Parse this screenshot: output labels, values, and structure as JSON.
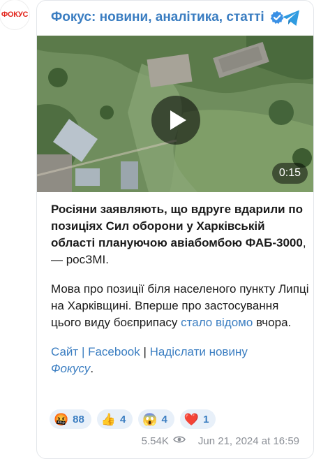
{
  "channel": {
    "avatar_text": "ФОКУС",
    "title": "Фокус: новини, аналітика, статті",
    "verified_icon": "verified-badge-icon",
    "share_icon": "telegram-share-icon"
  },
  "video": {
    "duration": "0:15",
    "play_icon": "play-icon"
  },
  "post": {
    "p1_bold": "Росіяни заявляють, що вдруге вдарили по позиціях Сил оборони у Харківській області плануючою авіабомбою ФАБ-3000",
    "p1_rest": ", — росЗМІ.",
    "p2_a": "Мова про позиції біля населеного пункту Липці на Харківщині. Вперше про застосування цього виду боєприпасу ",
    "p2_link": "стало відомо",
    "p2_b": " вчора.",
    "link_site": "Сайт",
    "sep1": " | ",
    "link_facebook": "Facebook",
    "sep2": " | ",
    "link_send": "Надіслати новину",
    "link_fokus": "Фокусу",
    "dot": "."
  },
  "reactions": [
    {
      "emoji": "🤬",
      "count": "88"
    },
    {
      "emoji": "👍",
      "count": "4"
    },
    {
      "emoji": "😱",
      "count": "4"
    },
    {
      "emoji": "❤️",
      "count": "1"
    }
  ],
  "footer": {
    "views": "5.54K",
    "views_icon": "eye-icon",
    "date": "Jun 21, 2024 at 16:59"
  },
  "colors": {
    "accent": "#3a7dc1",
    "brand_red": "#e2231a",
    "reaction_bg": "#e8f0f9",
    "meta_text": "#8b8f96"
  }
}
